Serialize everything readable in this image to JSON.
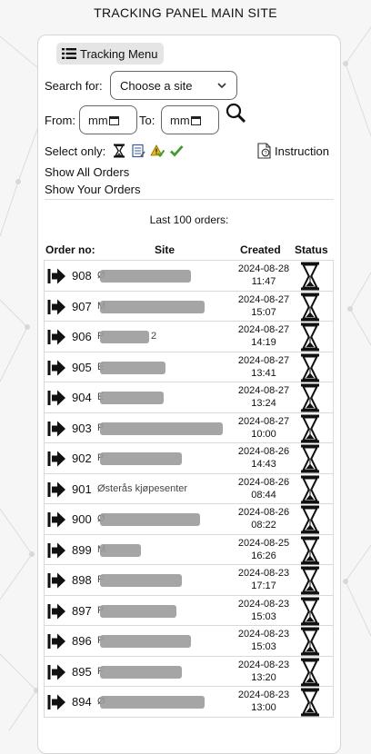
{
  "page_title": "TRACKING PANEL MAIN SITE",
  "menu": {
    "label": "Tracking Menu",
    "icon": "list-icon"
  },
  "search": {
    "label": "Search for:",
    "placeholder": "Choose a site"
  },
  "date_range": {
    "from_label": "From:",
    "to_label": "To:",
    "from_placeholder": "mm",
    "to_placeholder": "mm"
  },
  "filters": {
    "label": "Select only:",
    "icons": [
      "hourglass-icon",
      "notepad-icon",
      "warning-check-icon",
      "checkmark-icon"
    ]
  },
  "instruction_label": "Instruction",
  "links": {
    "show_all": "Show All Orders",
    "show_yours": "Show Your Orders"
  },
  "last_orders_label": "Last 100 orders:",
  "table": {
    "headers": {
      "order": "Order no:",
      "site": "Site",
      "created": "Created",
      "status": "Status"
    },
    "rows": [
      {
        "order": "908",
        "site_visible": "Ø",
        "date": "2024-08-28",
        "time": "11:47"
      },
      {
        "order": "907",
        "site_visible": "M",
        "date": "2024-08-27",
        "time": "15:07"
      },
      {
        "order": "906",
        "site_visible": "P",
        "site_suffix": "2",
        "date": "2024-08-27",
        "time": "14:19"
      },
      {
        "order": "905",
        "site_visible": "E",
        "date": "2024-08-27",
        "time": "13:41"
      },
      {
        "order": "904",
        "site_visible": "E",
        "date": "2024-08-27",
        "time": "13:24"
      },
      {
        "order": "903",
        "site_visible": "P",
        "date": "2024-08-27",
        "time": "10:00"
      },
      {
        "order": "902",
        "site_visible": "P",
        "date": "2024-08-26",
        "time": "14:43"
      },
      {
        "order": "901",
        "site_visible": "Østerås kjøpesenter",
        "date": "2024-08-26",
        "time": "08:44"
      },
      {
        "order": "900",
        "site_visible": "Ø",
        "date": "2024-08-26",
        "time": "08:22"
      },
      {
        "order": "899",
        "site_visible": "M",
        "date": "2024-08-25",
        "time": "16:26"
      },
      {
        "order": "898",
        "site_visible": "F",
        "date": "2024-08-23",
        "time": "17:17"
      },
      {
        "order": "897",
        "site_visible": "P",
        "date": "2024-08-23",
        "time": "15:03"
      },
      {
        "order": "896",
        "site_visible": "P",
        "date": "2024-08-23",
        "time": "15:03"
      },
      {
        "order": "895",
        "site_visible": "F",
        "date": "2024-08-23",
        "time": "13:20"
      },
      {
        "order": "894",
        "site_visible": "Ø",
        "date": "2024-08-23",
        "time": "13:00"
      }
    ]
  },
  "colors": {
    "accent_green": "#3f9b2f",
    "warning_yellow": "#e3b719",
    "link_text": "#111111"
  }
}
